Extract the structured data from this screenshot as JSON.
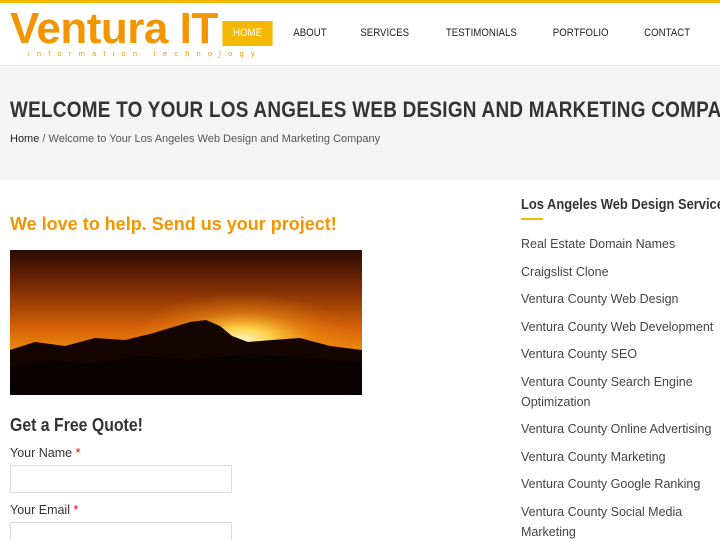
{
  "colors": {
    "accent": "#f5b800",
    "brand_orange": "#f29500"
  },
  "logo": {
    "name": "Ventura IT",
    "trademark": ".",
    "tagline": "information technology"
  },
  "nav": [
    {
      "label": "HOME",
      "active": true
    },
    {
      "label": "ABOUT"
    },
    {
      "label": "SERVICES"
    },
    {
      "label": "TESTIMONIALS"
    },
    {
      "label": "PORTFOLIO"
    },
    {
      "label": "CONTACT"
    }
  ],
  "banner": {
    "title": "WELCOME TO YOUR LOS ANGELES WEB DESIGN AND MARKETING COMPANY",
    "breadcrumb_home": "Home",
    "breadcrumb_separator": " / ",
    "breadcrumb_current": "Welcome to Your Los Angeles Web Design and Marketing Company"
  },
  "main": {
    "tagline": "We love to help.  Send us your project!",
    "form_title": "Get a Free Quote!",
    "required_marker": "*",
    "fields": [
      {
        "label": "Your Name",
        "value": "",
        "placeholder": ""
      },
      {
        "label": "Your Email",
        "value": "",
        "placeholder": ""
      }
    ]
  },
  "sidebar": {
    "title": "Los Angeles Web Design Services",
    "items": [
      "Real Estate Domain Names",
      "Craigslist Clone",
      "Ventura County Web Design",
      "Ventura County Web Development",
      "Ventura County SEO",
      "Ventura County Search Engine Optimization",
      "Ventura County Online Advertising",
      "Ventura County Marketing",
      "Ventura County Google Ranking",
      "Ventura County Social Media Marketing"
    ]
  }
}
